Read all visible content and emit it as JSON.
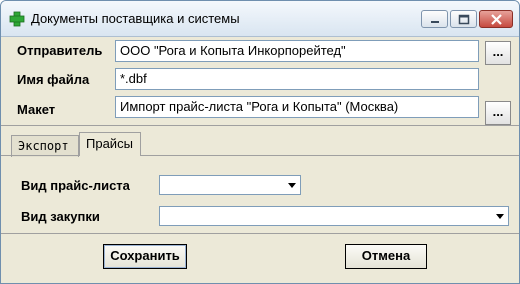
{
  "window": {
    "title": "Документы поставщика и системы",
    "icon": "green-cross-icon"
  },
  "form": {
    "sender_label": "Отправитель",
    "sender_value": "ООО \"Рога и Копыта Инкорпорейтед\"",
    "filename_label": "Имя файла",
    "filename_value": "*.dbf",
    "template_label": "Макет",
    "template_value": "Импорт прайс-листа \"Рога и Копыта\" (Москва)",
    "browse_label": "..."
  },
  "tabs": [
    {
      "label": "Экспорт",
      "active": false
    },
    {
      "label": "Прайсы",
      "active": true
    }
  ],
  "prices": {
    "pricelist_type_label": "Вид прайс-листа",
    "pricelist_type_value": "",
    "purchase_type_label": "Вид закупки",
    "purchase_type_value": ""
  },
  "buttons": {
    "save": "Сохранить",
    "cancel": "Отмена"
  },
  "colors": {
    "background": "#ece9d8",
    "field_border": "#7f9db9",
    "close_button": "#c64a3f"
  }
}
